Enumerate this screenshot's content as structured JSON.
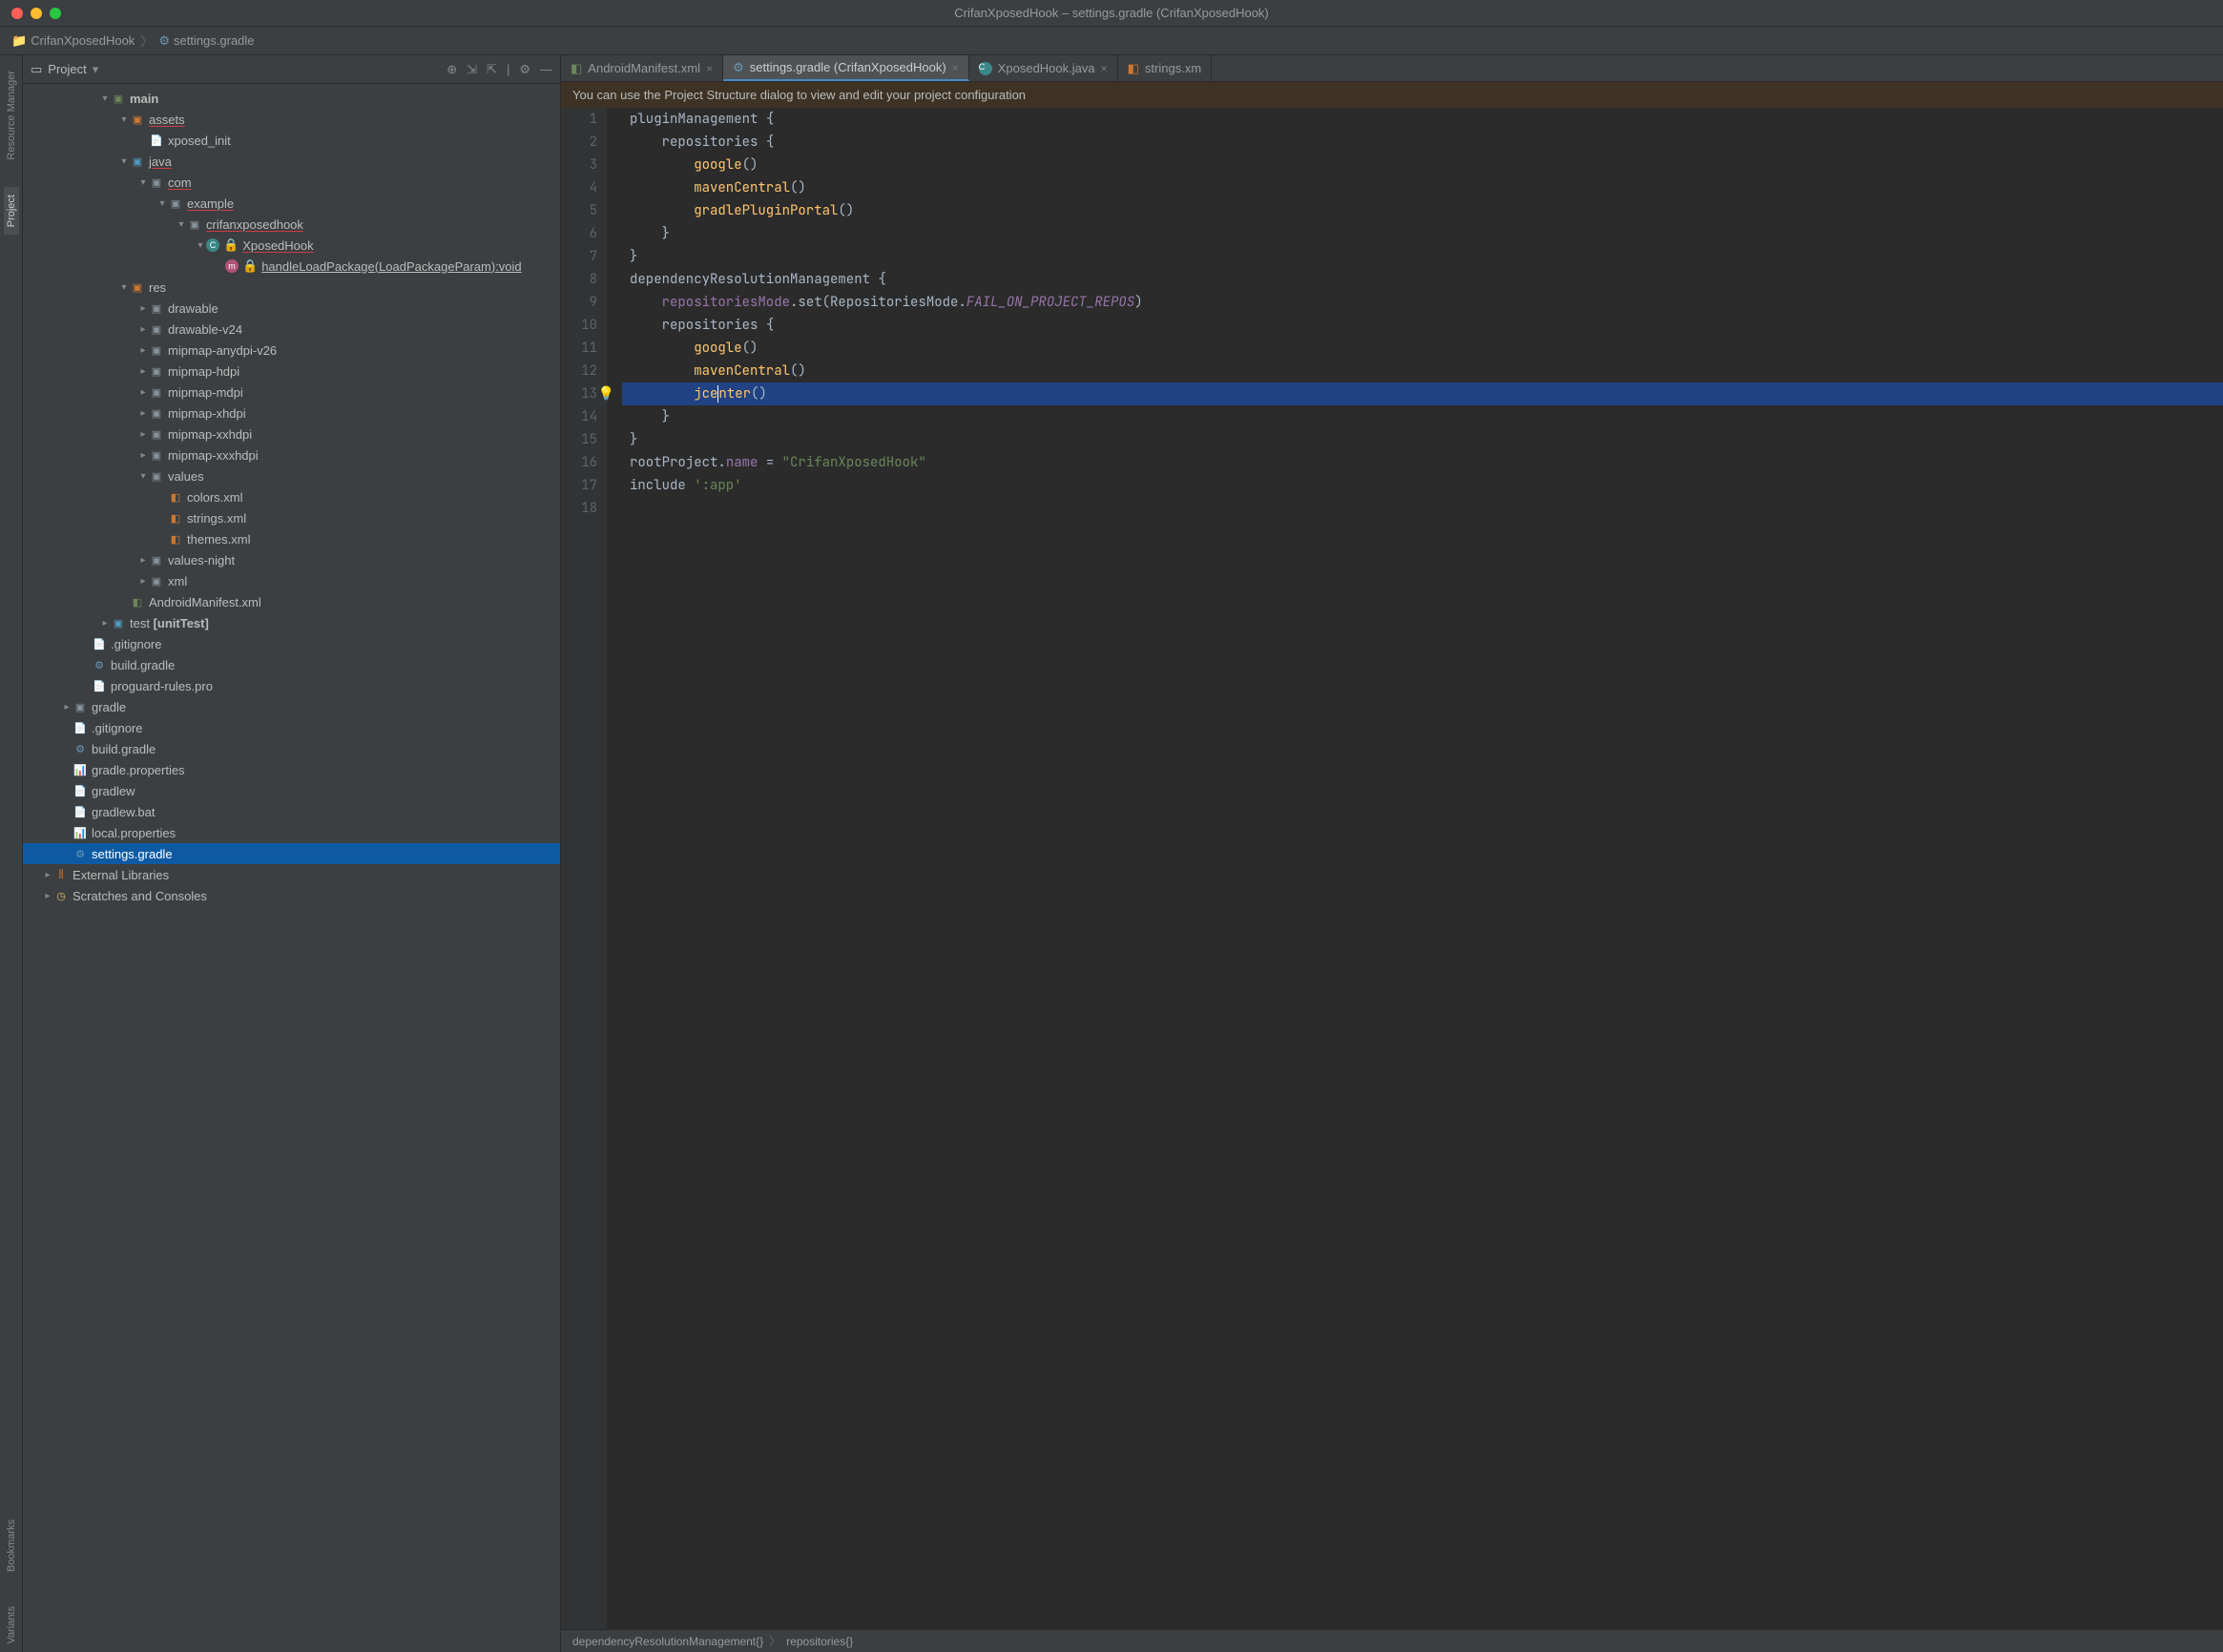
{
  "window": {
    "title": "CrifanXposedHook – settings.gradle (CrifanXposedHook)"
  },
  "breadcrumb": {
    "project": "CrifanXposedHook",
    "file": "settings.gradle"
  },
  "leftStrip": {
    "tab1": "Resource Manager",
    "tab2": "Project",
    "tab3": "Bookmarks",
    "tab4": "Variants"
  },
  "projectPanel": {
    "title": "Project"
  },
  "tree": {
    "main": "main",
    "assets": "assets",
    "xposed_init": "xposed_init",
    "java": "java",
    "com": "com",
    "example": "example",
    "crifanxposedhook": "crifanxposedhook",
    "XposedHook": "XposedHook",
    "handleLoadPackage": "handleLoadPackage(LoadPackageParam):void",
    "res": "res",
    "drawable": "drawable",
    "drawable_v24": "drawable-v24",
    "mipmap_anydpi_v26": "mipmap-anydpi-v26",
    "mipmap_hdpi": "mipmap-hdpi",
    "mipmap_mdpi": "mipmap-mdpi",
    "mipmap_xhdpi": "mipmap-xhdpi",
    "mipmap_xxhdpi": "mipmap-xxhdpi",
    "mipmap_xxxhdpi": "mipmap-xxxhdpi",
    "values": "values",
    "colors_xml": "colors.xml",
    "strings_xml": "strings.xml",
    "themes_xml": "themes.xml",
    "values_night": "values-night",
    "xml": "xml",
    "manifest": "AndroidManifest.xml",
    "test": "test ",
    "test_suffix": "[unitTest]",
    "gitignore": ".gitignore",
    "build_gradle": "build.gradle",
    "proguard": "proguard-rules.pro",
    "gradle": "gradle",
    "gitignore2": ".gitignore",
    "build_gradle2": "build.gradle",
    "gradle_properties": "gradle.properties",
    "gradlew": "gradlew",
    "gradlew_bat": "gradlew.bat",
    "local_properties": "local.properties",
    "settings_gradle": "settings.gradle",
    "external_libs": "External Libraries",
    "scratches": "Scratches and Consoles"
  },
  "tabs": {
    "t1": "AndroidManifest.xml",
    "t2": "settings.gradle (CrifanXposedHook)",
    "t3": "XposedHook.java",
    "t4": "strings.xm"
  },
  "banner": {
    "text": "You can use the Project Structure dialog to view and edit your project configuration"
  },
  "code": {
    "l1a": "pluginManagement ",
    "l1b": "{",
    "l2a": "    repositories ",
    "l2b": "{",
    "l3a": "        ",
    "l3b": "google",
    "l3c": "()",
    "l4a": "        ",
    "l4b": "mavenCentral",
    "l4c": "()",
    "l5a": "        ",
    "l5b": "gradlePluginPortal",
    "l5c": "()",
    "l6": "    }",
    "l7": "}",
    "l8a": "dependencyResolutionManagement ",
    "l8b": "{",
    "l9a": "    ",
    "l9b": "repositoriesMode",
    "l9c": ".set(RepositoriesMode.",
    "l9d": "FAIL_ON_PROJECT_REPOS",
    "l9e": ")",
    "l10a": "    repositories ",
    "l10b": "{",
    "l11a": "        ",
    "l11b": "google",
    "l11c": "()",
    "l12a": "        ",
    "l12b": "mavenCentral",
    "l12c": "()",
    "l13a": "        ",
    "l13b": "jce",
    "l13c": "nter",
    "l13d": "()",
    "l14": "    }",
    "l15": "}",
    "l16a": "rootProject",
    "l16b": ".",
    "l16c": "name",
    "l16d": " = ",
    "l16e": "\"CrifanXposedHook\"",
    "l17a": "include ",
    "l17b": "':app'",
    "ln1": "1",
    "ln2": "2",
    "ln3": "3",
    "ln4": "4",
    "ln5": "5",
    "ln6": "6",
    "ln7": "7",
    "ln8": "8",
    "ln9": "9",
    "ln10": "10",
    "ln11": "11",
    "ln12": "12",
    "ln13": "13",
    "ln14": "14",
    "ln15": "15",
    "ln16": "16",
    "ln17": "17",
    "ln18": "18"
  },
  "footer": {
    "p1": "dependencyResolutionManagement{}",
    "p2": "repositories{}"
  }
}
